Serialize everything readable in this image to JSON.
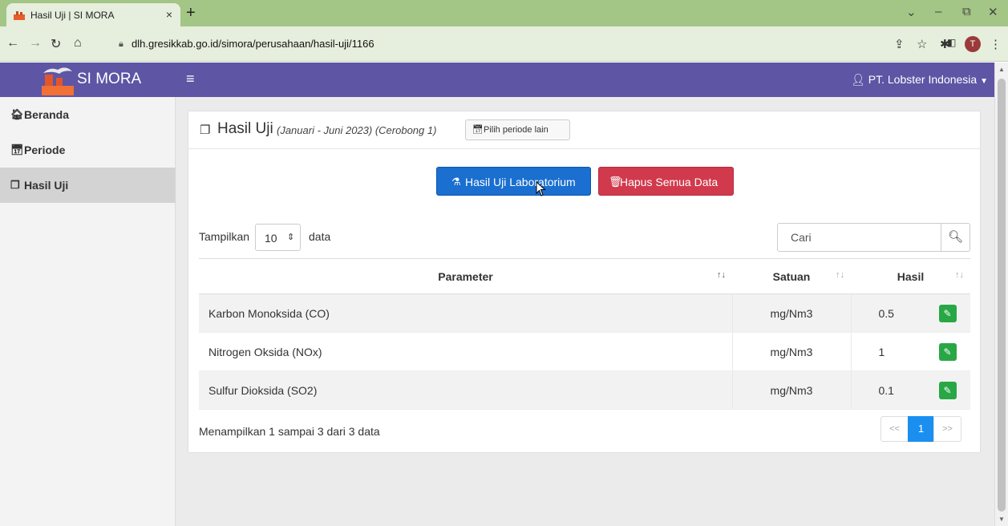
{
  "browser": {
    "tab_title": "Hasil Uji | SI MORA",
    "tab_close": "×",
    "new_tab": "+",
    "url": "dlh.gresikkab.go.id/simora/perusahaan/hasil-uji/1166",
    "profile_initial": "T"
  },
  "header": {
    "brand": "SI MORA",
    "menu_icon": "≡",
    "user": "PT. Lobster Indonesia"
  },
  "sidebar": {
    "items": [
      {
        "label": "Beranda",
        "icon": "home-icon"
      },
      {
        "label": "Periode",
        "icon": "calendar-icon"
      },
      {
        "label": "Hasil Uji",
        "icon": "copy-icon",
        "active": true
      }
    ]
  },
  "panel": {
    "title": "Hasil Uji",
    "subtitle": "(Januari - Juni 2023) (Cerobong 1)",
    "change_period_label": "Pilih periode lain",
    "lab_button_label": "Hasil Uji Laboratorium",
    "delete_all_label": "Hapus Semua Data"
  },
  "table_controls": {
    "length_prefix": "Tampilkan",
    "length_value": "10",
    "length_suffix": "data",
    "search_placeholder": "Cari"
  },
  "table": {
    "headers": [
      "Parameter",
      "Satuan",
      "Hasil"
    ],
    "rows": [
      {
        "parameter": "Karbon Monoksida (CO)",
        "satuan": "mg/Nm3",
        "hasil": "0.5"
      },
      {
        "parameter": "Nitrogen Oksida (NOx)",
        "satuan": "mg/Nm3",
        "hasil": "1"
      },
      {
        "parameter": "Sulfur Dioksida (SO2)",
        "satuan": "mg/Nm3",
        "hasil": "0.1"
      }
    ]
  },
  "footer": {
    "info": "Menampilkan 1 sampai 3 dari 3 data",
    "prev": "<<",
    "current_page": "1",
    "next": ">>"
  },
  "colors": {
    "header_bg": "#5e55a5",
    "primary": "#1a6fd0",
    "danger": "#d13a4c",
    "success": "#28a745"
  }
}
